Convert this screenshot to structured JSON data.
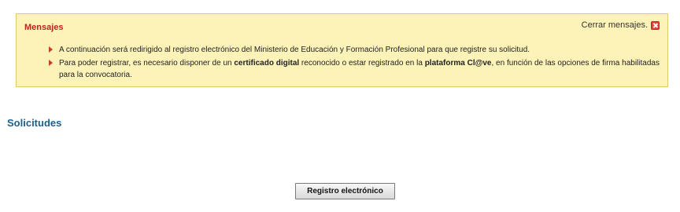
{
  "messages": {
    "title": "Mensajes",
    "close_label": "Cerrar mensajes.",
    "items": [
      {
        "parts": [
          {
            "text": "A continuación será redirigido al registro electrónico del Ministerio de Educación y Formación Profesional para que registre su solicitud.",
            "bold": false
          }
        ]
      },
      {
        "parts": [
          {
            "text": "Para poder registrar, es necesario disponer de un ",
            "bold": false
          },
          {
            "text": "certificado digital",
            "bold": true
          },
          {
            "text": " reconocido o estar registrado en la ",
            "bold": false
          },
          {
            "text": "plataforma Cl@ve",
            "bold": true
          },
          {
            "text": ", en función de las opciones de firma habilitadas para la convocatoria.",
            "bold": false
          }
        ]
      }
    ]
  },
  "section": {
    "title": "Solicitudes"
  },
  "actions": {
    "register_label": "Registro electrónico"
  },
  "colors": {
    "messages_background": "#fdf3b8",
    "messages_title": "#b7271d",
    "section_title": "#1b5f8c",
    "bullet": "#d03b22",
    "close_icon": "#e2453c"
  },
  "icons": {
    "close": "close-icon",
    "bullet": "bullet-arrow-icon"
  }
}
